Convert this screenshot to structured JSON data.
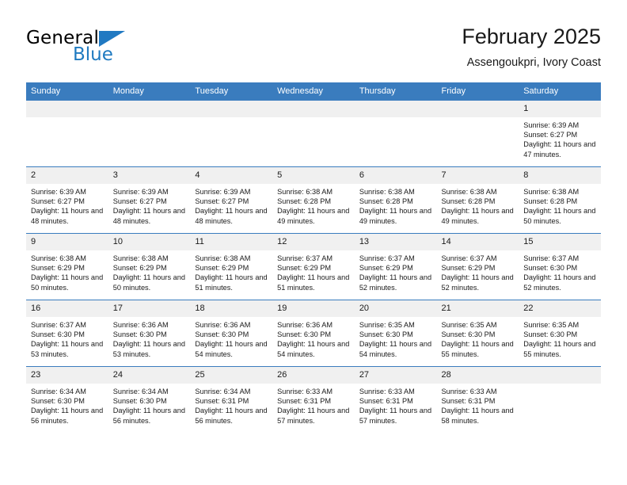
{
  "brand": {
    "name_top": "General",
    "name_bottom": "Blue",
    "accent_color": "#2079c2"
  },
  "header": {
    "month_title": "February 2025",
    "location": "Assengoukpri, Ivory Coast"
  },
  "theme": {
    "header_blue": "#3a7cbe",
    "daynum_band": "#f0f0f0",
    "text": "#1a1a1a"
  },
  "calendar": {
    "weekday_headers": [
      "Sunday",
      "Monday",
      "Tuesday",
      "Wednesday",
      "Thursday",
      "Friday",
      "Saturday"
    ],
    "weeks": [
      [
        {
          "day": "",
          "blank": true
        },
        {
          "day": "",
          "blank": true
        },
        {
          "day": "",
          "blank": true
        },
        {
          "day": "",
          "blank": true
        },
        {
          "day": "",
          "blank": true
        },
        {
          "day": "",
          "blank": true
        },
        {
          "day": "1",
          "sunrise": "Sunrise: 6:39 AM",
          "sunset": "Sunset: 6:27 PM",
          "daylight": "Daylight: 11 hours and 47 minutes."
        }
      ],
      [
        {
          "day": "2",
          "sunrise": "Sunrise: 6:39 AM",
          "sunset": "Sunset: 6:27 PM",
          "daylight": "Daylight: 11 hours and 48 minutes."
        },
        {
          "day": "3",
          "sunrise": "Sunrise: 6:39 AM",
          "sunset": "Sunset: 6:27 PM",
          "daylight": "Daylight: 11 hours and 48 minutes."
        },
        {
          "day": "4",
          "sunrise": "Sunrise: 6:39 AM",
          "sunset": "Sunset: 6:27 PM",
          "daylight": "Daylight: 11 hours and 48 minutes."
        },
        {
          "day": "5",
          "sunrise": "Sunrise: 6:38 AM",
          "sunset": "Sunset: 6:28 PM",
          "daylight": "Daylight: 11 hours and 49 minutes."
        },
        {
          "day": "6",
          "sunrise": "Sunrise: 6:38 AM",
          "sunset": "Sunset: 6:28 PM",
          "daylight": "Daylight: 11 hours and 49 minutes."
        },
        {
          "day": "7",
          "sunrise": "Sunrise: 6:38 AM",
          "sunset": "Sunset: 6:28 PM",
          "daylight": "Daylight: 11 hours and 49 minutes."
        },
        {
          "day": "8",
          "sunrise": "Sunrise: 6:38 AM",
          "sunset": "Sunset: 6:28 PM",
          "daylight": "Daylight: 11 hours and 50 minutes."
        }
      ],
      [
        {
          "day": "9",
          "sunrise": "Sunrise: 6:38 AM",
          "sunset": "Sunset: 6:29 PM",
          "daylight": "Daylight: 11 hours and 50 minutes."
        },
        {
          "day": "10",
          "sunrise": "Sunrise: 6:38 AM",
          "sunset": "Sunset: 6:29 PM",
          "daylight": "Daylight: 11 hours and 50 minutes."
        },
        {
          "day": "11",
          "sunrise": "Sunrise: 6:38 AM",
          "sunset": "Sunset: 6:29 PM",
          "daylight": "Daylight: 11 hours and 51 minutes."
        },
        {
          "day": "12",
          "sunrise": "Sunrise: 6:37 AM",
          "sunset": "Sunset: 6:29 PM",
          "daylight": "Daylight: 11 hours and 51 minutes."
        },
        {
          "day": "13",
          "sunrise": "Sunrise: 6:37 AM",
          "sunset": "Sunset: 6:29 PM",
          "daylight": "Daylight: 11 hours and 52 minutes."
        },
        {
          "day": "14",
          "sunrise": "Sunrise: 6:37 AM",
          "sunset": "Sunset: 6:29 PM",
          "daylight": "Daylight: 11 hours and 52 minutes."
        },
        {
          "day": "15",
          "sunrise": "Sunrise: 6:37 AM",
          "sunset": "Sunset: 6:30 PM",
          "daylight": "Daylight: 11 hours and 52 minutes."
        }
      ],
      [
        {
          "day": "16",
          "sunrise": "Sunrise: 6:37 AM",
          "sunset": "Sunset: 6:30 PM",
          "daylight": "Daylight: 11 hours and 53 minutes."
        },
        {
          "day": "17",
          "sunrise": "Sunrise: 6:36 AM",
          "sunset": "Sunset: 6:30 PM",
          "daylight": "Daylight: 11 hours and 53 minutes."
        },
        {
          "day": "18",
          "sunrise": "Sunrise: 6:36 AM",
          "sunset": "Sunset: 6:30 PM",
          "daylight": "Daylight: 11 hours and 54 minutes."
        },
        {
          "day": "19",
          "sunrise": "Sunrise: 6:36 AM",
          "sunset": "Sunset: 6:30 PM",
          "daylight": "Daylight: 11 hours and 54 minutes."
        },
        {
          "day": "20",
          "sunrise": "Sunrise: 6:35 AM",
          "sunset": "Sunset: 6:30 PM",
          "daylight": "Daylight: 11 hours and 54 minutes."
        },
        {
          "day": "21",
          "sunrise": "Sunrise: 6:35 AM",
          "sunset": "Sunset: 6:30 PM",
          "daylight": "Daylight: 11 hours and 55 minutes."
        },
        {
          "day": "22",
          "sunrise": "Sunrise: 6:35 AM",
          "sunset": "Sunset: 6:30 PM",
          "daylight": "Daylight: 11 hours and 55 minutes."
        }
      ],
      [
        {
          "day": "23",
          "sunrise": "Sunrise: 6:34 AM",
          "sunset": "Sunset: 6:30 PM",
          "daylight": "Daylight: 11 hours and 56 minutes."
        },
        {
          "day": "24",
          "sunrise": "Sunrise: 6:34 AM",
          "sunset": "Sunset: 6:30 PM",
          "daylight": "Daylight: 11 hours and 56 minutes."
        },
        {
          "day": "25",
          "sunrise": "Sunrise: 6:34 AM",
          "sunset": "Sunset: 6:31 PM",
          "daylight": "Daylight: 11 hours and 56 minutes."
        },
        {
          "day": "26",
          "sunrise": "Sunrise: 6:33 AM",
          "sunset": "Sunset: 6:31 PM",
          "daylight": "Daylight: 11 hours and 57 minutes."
        },
        {
          "day": "27",
          "sunrise": "Sunrise: 6:33 AM",
          "sunset": "Sunset: 6:31 PM",
          "daylight": "Daylight: 11 hours and 57 minutes."
        },
        {
          "day": "28",
          "sunrise": "Sunrise: 6:33 AM",
          "sunset": "Sunset: 6:31 PM",
          "daylight": "Daylight: 11 hours and 58 minutes."
        },
        {
          "day": "",
          "blank": true
        }
      ]
    ]
  }
}
